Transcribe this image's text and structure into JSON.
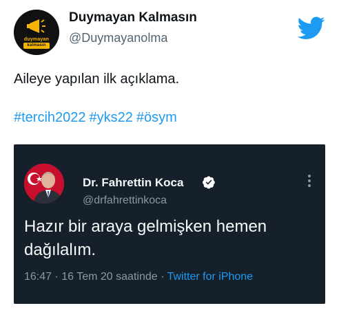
{
  "tweet": {
    "author_name": "Duymayan Kalmasın",
    "author_handle": "@Duymayanolma",
    "avatar_logo_line1": "duymayan",
    "avatar_logo_line2": "kalmasın",
    "text": "Aileye yapılan ilk açıklama.",
    "hashtags": [
      "#tercih2022",
      "#yks22",
      "#ösym"
    ],
    "brand_icon": "twitter-bird-icon",
    "brand_color": "#1d9bf0"
  },
  "quoted": {
    "author_name": "Dr. Fahrettin Koca",
    "author_handle": "@drfahrettinkoca",
    "text": "Hazır bir araya gelmişken hemen dağılalım.",
    "time": "16:47",
    "separator": "·",
    "date": "16 Tem 20 saatinde",
    "source": "Twitter for iPhone",
    "verified_icon": "verified-badge-icon",
    "more_icon": "more-vertical-icon",
    "background_color": "#15202b"
  }
}
